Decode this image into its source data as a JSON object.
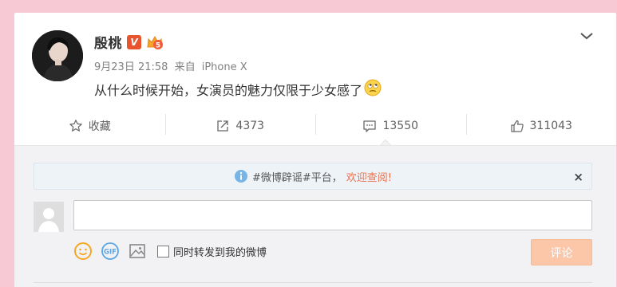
{
  "post": {
    "author": "殷桃",
    "verified_badge": "V",
    "level_badge": "5",
    "date": "9月23日 21:58",
    "source_prefix": "来自",
    "source": "iPhone X",
    "text": "从什么时候开始，女演员的魅力仅限于少女感了",
    "emoji": "rolling-eyes-emoji"
  },
  "actions": {
    "favorite_label": "收藏",
    "repost_count": "4373",
    "comment_count": "13550",
    "like_count": "311043"
  },
  "notice": {
    "text": "#微博辟谣#平台，",
    "link": "欢迎查阅!",
    "close": "×"
  },
  "comment_box": {
    "input_value": "",
    "also_repost_label": "同时转发到我的微博",
    "also_repost_checked": false,
    "submit_label": "评论"
  },
  "colors": {
    "accent": "#eb7350",
    "submit_disabled": "#fbc7a8",
    "page_bg": "#f6c9d4"
  }
}
